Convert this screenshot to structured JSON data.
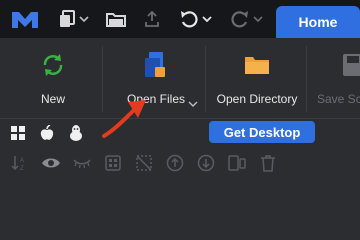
{
  "topbar": {
    "logo_icon": "app-logo-icon",
    "icons": [
      "new-document-icon",
      "chevron-down-icon",
      "open-folder-icon",
      "upload-icon",
      "undo-icon",
      "chevron-down-icon",
      "redo-icon",
      "chevron-down-icon"
    ],
    "home_tab": "Home"
  },
  "ribbon": {
    "new_label": "New",
    "open_files_label": "Open Files",
    "open_directory_label": "Open Directory",
    "save_label": "Save Sce"
  },
  "os_row": {
    "icons": [
      "windows-icon",
      "apple-icon",
      "linux-icon"
    ],
    "get_desktop": "Get Desktop"
  },
  "tools": [
    "sort-az-icon",
    "eye-icon",
    "hide-icon",
    "grid-select-icon",
    "crop-icon",
    "arrow-up-circle-icon",
    "arrow-down-circle-icon",
    "split-view-icon",
    "trash-icon"
  ],
  "colors": {
    "accent": "#2f6fe0",
    "new_icon": "#3cb043",
    "folder_icon": "#f0a03a",
    "annotation_arrow": "#e23b1f"
  }
}
